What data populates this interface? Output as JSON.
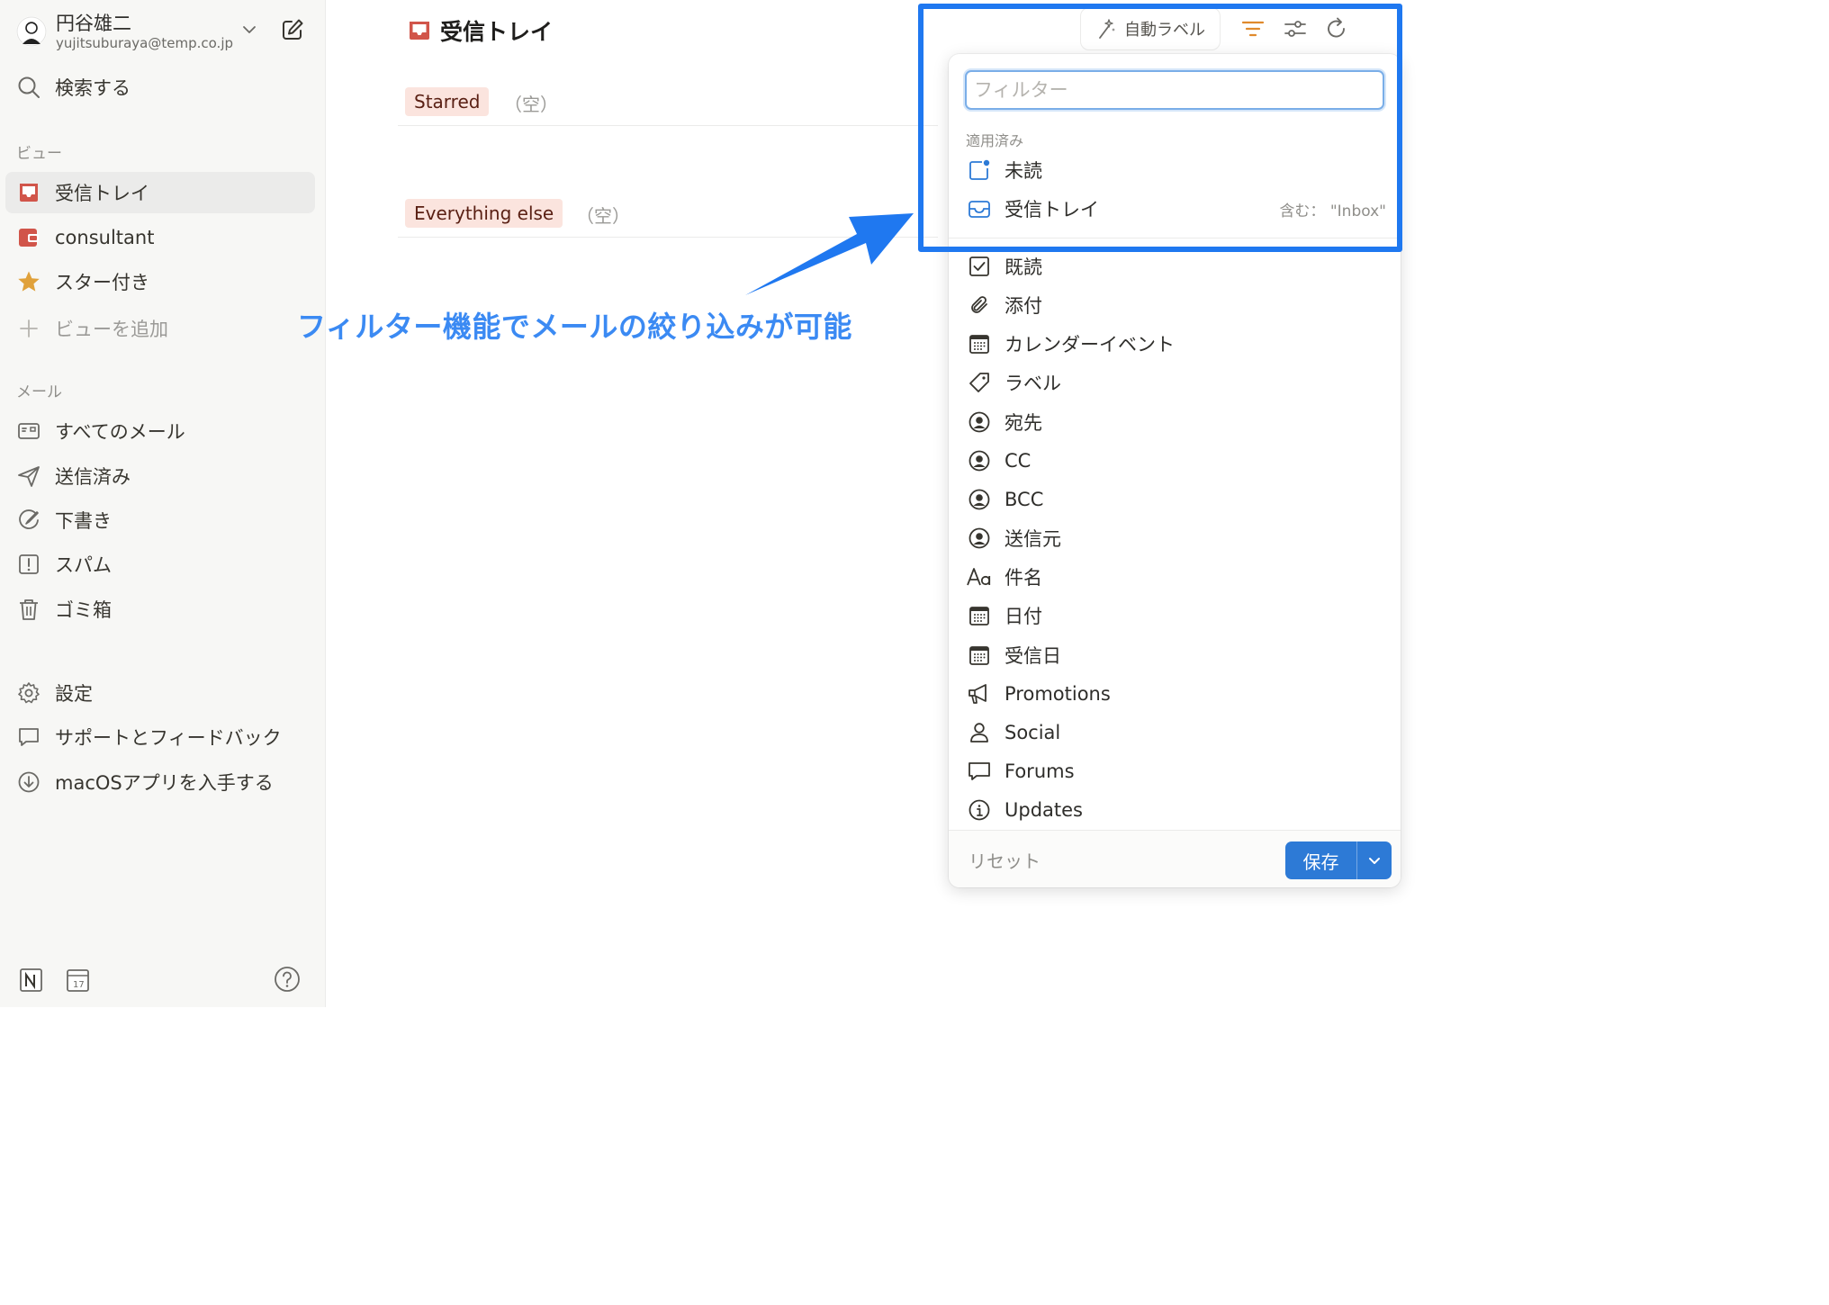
{
  "account": {
    "name": "円谷雄二",
    "email": "yujitsuburaya@temp.co.jp"
  },
  "sidebar": {
    "search_label": "検索する",
    "views_heading": "ビュー",
    "views": [
      {
        "label": "受信トレイ",
        "icon": "inbox-icon",
        "active": true
      },
      {
        "label": "consultant",
        "icon": "consultant-label-icon",
        "active": false
      },
      {
        "label": "スター付き",
        "icon": "star-icon",
        "active": false
      }
    ],
    "add_view_label": "ビューを追加",
    "mail_heading": "メール",
    "mail_items": [
      {
        "label": "すべてのメール",
        "icon": "all-mail-icon"
      },
      {
        "label": "送信済み",
        "icon": "send-icon"
      },
      {
        "label": "下書き",
        "icon": "draft-icon"
      },
      {
        "label": "スパム",
        "icon": "spam-icon"
      },
      {
        "label": "ゴミ箱",
        "icon": "trash-icon"
      }
    ],
    "settings_label": "設定",
    "support_label": "サポートとフィードバック",
    "macos_label": "macOSアプリを入手する"
  },
  "main": {
    "title": "受信トレイ",
    "groups": [
      {
        "tag": "Starred",
        "empty": "（空）"
      },
      {
        "tag": "Everything else",
        "empty": "（空）"
      }
    ]
  },
  "toolbar": {
    "autolabel_label": "自動ラベル"
  },
  "filter": {
    "placeholder": "フィルター",
    "applied_heading": "適用済み",
    "applied": [
      {
        "label": "未読",
        "icon": "unread-icon",
        "meta": ""
      },
      {
        "label": "受信トレイ",
        "icon": "inbox-tray-icon",
        "meta": "含む： \"Inbox\""
      }
    ],
    "options": [
      {
        "label": "既読",
        "icon": "checkbox-icon"
      },
      {
        "label": "添付",
        "icon": "paperclip-icon"
      },
      {
        "label": "カレンダーイベント",
        "icon": "calendar-icon"
      },
      {
        "label": "ラベル",
        "icon": "tag-icon"
      },
      {
        "label": "宛先",
        "icon": "person-circle-icon"
      },
      {
        "label": "CC",
        "icon": "person-circle-icon"
      },
      {
        "label": "BCC",
        "icon": "person-circle-icon"
      },
      {
        "label": "送信元",
        "icon": "person-circle-icon"
      },
      {
        "label": "件名",
        "icon": "text-aa-icon"
      },
      {
        "label": "日付",
        "icon": "calendar-icon"
      },
      {
        "label": "受信日",
        "icon": "calendar-icon"
      },
      {
        "label": "Promotions",
        "icon": "megaphone-icon"
      },
      {
        "label": "Social",
        "icon": "person-icon"
      },
      {
        "label": "Forums",
        "icon": "chat-bubble-icon"
      },
      {
        "label": "Updates",
        "icon": "info-icon"
      }
    ],
    "reset_label": "リセット",
    "save_label": "保存"
  },
  "annotation": {
    "text": "フィルター機能でメールの絞り込みが可能"
  },
  "colors": {
    "accent": "#2d7ad6",
    "annotation_blue": "#1f78f0",
    "inbox_red": "#d1554a",
    "star": "#e0a13a",
    "filter_active": "#e08a2c",
    "tag_bg": "#fbe4de"
  }
}
